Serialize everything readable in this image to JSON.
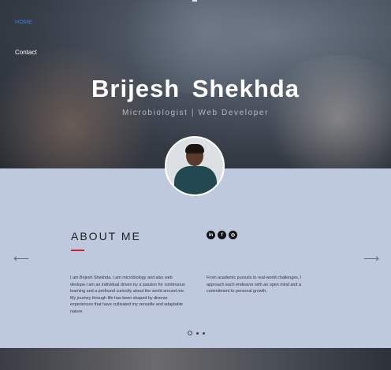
{
  "nav": {
    "home": "HOME",
    "contact": "Contact"
  },
  "hero": {
    "name": "Brijesh  Shekhda",
    "subtitle": "Microbiologist | Web Developer"
  },
  "about": {
    "title": "ABOUT ME",
    "accent_color": "#d0202a",
    "paragraph_left": "I am  Brijesh Shekhda. I am microbiology and also web devlope.I am an individual driven by a passion for continuous learning and a profound curiosity about the world around me. My journey through life has been shaped by diverse experiences that have cultivated my versatile and adaptable nature.",
    "paragraph_right": "From academic pursuits to real-world challenges, I approach each endeavor with an open mind and a commitment to personal growth."
  },
  "social": [
    {
      "icon": "linkedin-icon",
      "glyph": "in"
    },
    {
      "icon": "facebook-icon",
      "glyph": "f"
    },
    {
      "icon": "instagram-icon",
      "glyph": "◎"
    }
  ],
  "carousel": {
    "prev": "⟵",
    "next": "⟶",
    "slides": 3,
    "active": 1
  },
  "colors": {
    "panel": "#bfc9dd",
    "nav_active": "#3b82d6"
  }
}
